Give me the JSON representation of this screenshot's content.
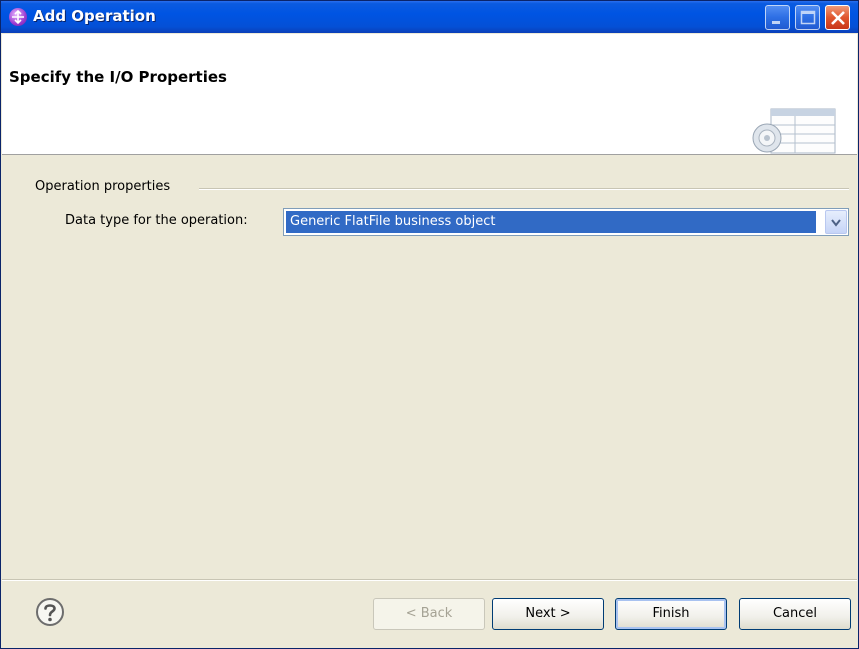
{
  "window": {
    "title": "Add Operation",
    "app_icon": "wizard-app-icon",
    "controls": [
      "minimize-icon",
      "maximize-icon",
      "close-icon"
    ]
  },
  "header": {
    "title": "Specify the I/O Properties",
    "graphic": "wizard-banner-graphic"
  },
  "operation_properties": {
    "group_label": "Operation properties",
    "data_type_label": "Data type for the operation:",
    "data_type_value": "Generic FlatFile business object"
  },
  "buttons": {
    "back": "< Back",
    "next": "Next >",
    "finish": "Finish",
    "cancel": "Cancel",
    "help_icon": "help-icon"
  },
  "colors": {
    "titlebar": "#0054e3",
    "selection": "#316ac5",
    "dialog_bg": "#ece9d8"
  }
}
